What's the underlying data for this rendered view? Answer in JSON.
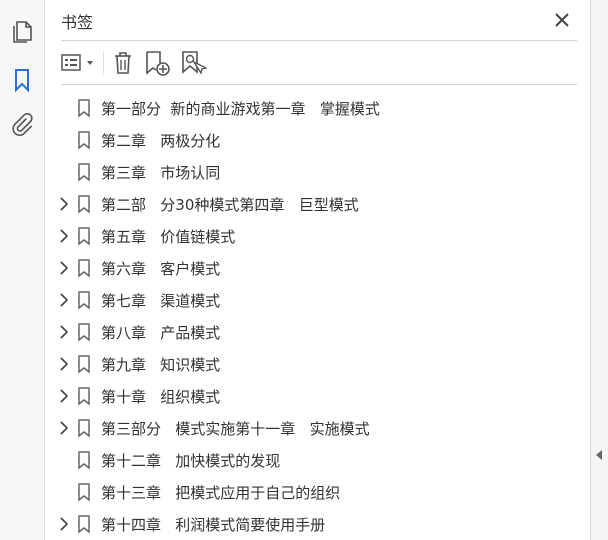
{
  "panel": {
    "title": "书签",
    "close_icon": "close-icon"
  },
  "left_rail": {
    "items": [
      {
        "name": "pages-thumbnail-icon"
      },
      {
        "name": "bookmark-icon",
        "active": true
      },
      {
        "name": "attachment-icon"
      }
    ]
  },
  "toolbar": {
    "items": [
      {
        "name": "options-menu-icon"
      },
      {
        "name": "delete-bookmark-icon"
      },
      {
        "name": "new-bookmark-icon"
      },
      {
        "name": "find-current-bookmark-icon"
      }
    ]
  },
  "bookmarks": [
    {
      "label": "第一部分  新的商业游戏第一章   掌握模式",
      "expandable": false
    },
    {
      "label": "第二章   两极分化",
      "expandable": false
    },
    {
      "label": "第三章   市场认同",
      "expandable": false
    },
    {
      "label": "第二部   分30种模式第四章   巨型模式",
      "expandable": true
    },
    {
      "label": "第五章   价值链模式",
      "expandable": true
    },
    {
      "label": "第六章   客户模式",
      "expandable": true
    },
    {
      "label": "第七章   渠道模式",
      "expandable": true
    },
    {
      "label": "第八章   产品模式",
      "expandable": true
    },
    {
      "label": "第九章   知识模式",
      "expandable": true
    },
    {
      "label": "第十章   组织模式",
      "expandable": true
    },
    {
      "label": "第三部分   模式实施第十一章   实施模式",
      "expandable": true
    },
    {
      "label": "第十二章   加快模式的发现",
      "expandable": false
    },
    {
      "label": "第十三章   把模式应用于自己的组织",
      "expandable": false
    },
    {
      "label": "第十四章   利润模式简要使用手册",
      "expandable": true
    }
  ],
  "colors": {
    "accent": "#2a6fd6",
    "icon": "#555555",
    "text": "#333333"
  }
}
